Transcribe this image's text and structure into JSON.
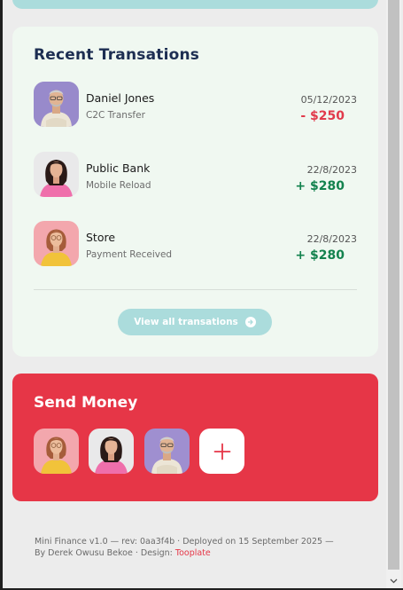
{
  "transactions": {
    "title": "Recent Transations",
    "items": [
      {
        "name": "Daniel Jones",
        "type": "C2C Transfer",
        "date": "05/12/2023",
        "amount": "- $250",
        "direction": "negative"
      },
      {
        "name": "Public Bank",
        "type": "Mobile Reload",
        "date": "22/8/2023",
        "amount": "+ $280",
        "direction": "positive"
      },
      {
        "name": "Store",
        "type": "Payment Received",
        "date": "22/8/2023",
        "amount": "+ $280",
        "direction": "positive"
      }
    ],
    "view_all_label": "View all transations"
  },
  "send_money": {
    "title": "Send Money",
    "contacts": [
      "woman-yellow-avatar",
      "woman-pink-avatar",
      "man-beige-avatar"
    ],
    "add_icon": "plus-icon"
  },
  "footer": {
    "line1": "Mini Finance v1.0 — rev: 0aa3f4b · Deployed on 15 September 2025 —",
    "line2_prefix": "By Derek Owusu Bekoe · Design: ",
    "design_link": "Tooplate"
  },
  "colors": {
    "accent_red": "#e63647",
    "teal": "#abdcdc",
    "navy": "#1d2e52",
    "positive": "#13824e",
    "negative": "#e13a4b"
  }
}
